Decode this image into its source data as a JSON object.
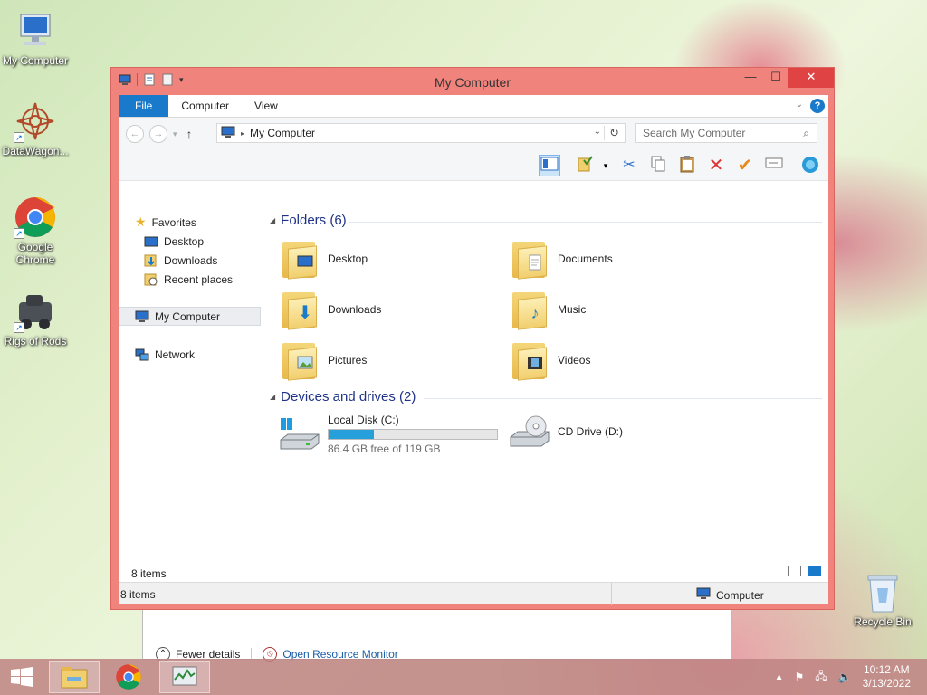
{
  "desktop": {
    "icons": [
      {
        "label": "My Computer"
      },
      {
        "label": "DataWagon..."
      },
      {
        "label": "Google Chrome"
      },
      {
        "label": "Rigs of Rods"
      }
    ],
    "recycle_bin": "Recycle Bin"
  },
  "behind_window": {
    "fewer_details": "Fewer details",
    "resource_monitor": "Open Resource Monitor"
  },
  "window": {
    "title": "My Computer",
    "ribbon_tabs": [
      "File",
      "Computer",
      "View"
    ],
    "address": "My Computer",
    "search_placeholder": "Search My Computer",
    "nav": {
      "favorites": "Favorites",
      "desktop": "Desktop",
      "downloads": "Downloads",
      "recent": "Recent places",
      "my_computer": "My Computer",
      "network": "Network"
    },
    "folders_header": "Folders (6)",
    "folders": [
      {
        "name": "Desktop",
        "icon": "desktop-icon"
      },
      {
        "name": "Documents",
        "icon": "documents-icon"
      },
      {
        "name": "Downloads",
        "icon": "download-arrow-icon"
      },
      {
        "name": "Music",
        "icon": "music-note-icon"
      },
      {
        "name": "Pictures",
        "icon": "picture-icon"
      },
      {
        "name": "Videos",
        "icon": "film-icon"
      }
    ],
    "devices_header": "Devices and drives (2)",
    "drives": [
      {
        "name": "Local Disk (C:)",
        "free": "86.4 GB free of 119 GB",
        "used_fraction": 0.27
      },
      {
        "name": "CD Drive (D:)"
      }
    ],
    "item_count": "8 items",
    "status_count": "8 items",
    "status_location": "Computer"
  },
  "taskbar": {
    "time": "10:12 AM",
    "date": "3/13/2022"
  },
  "colors": {
    "accent": "#1979ca",
    "title_bar": "#f0837c",
    "close_button": "#e04343",
    "heading": "#1e3287",
    "drive_bar": "#26a0da"
  }
}
